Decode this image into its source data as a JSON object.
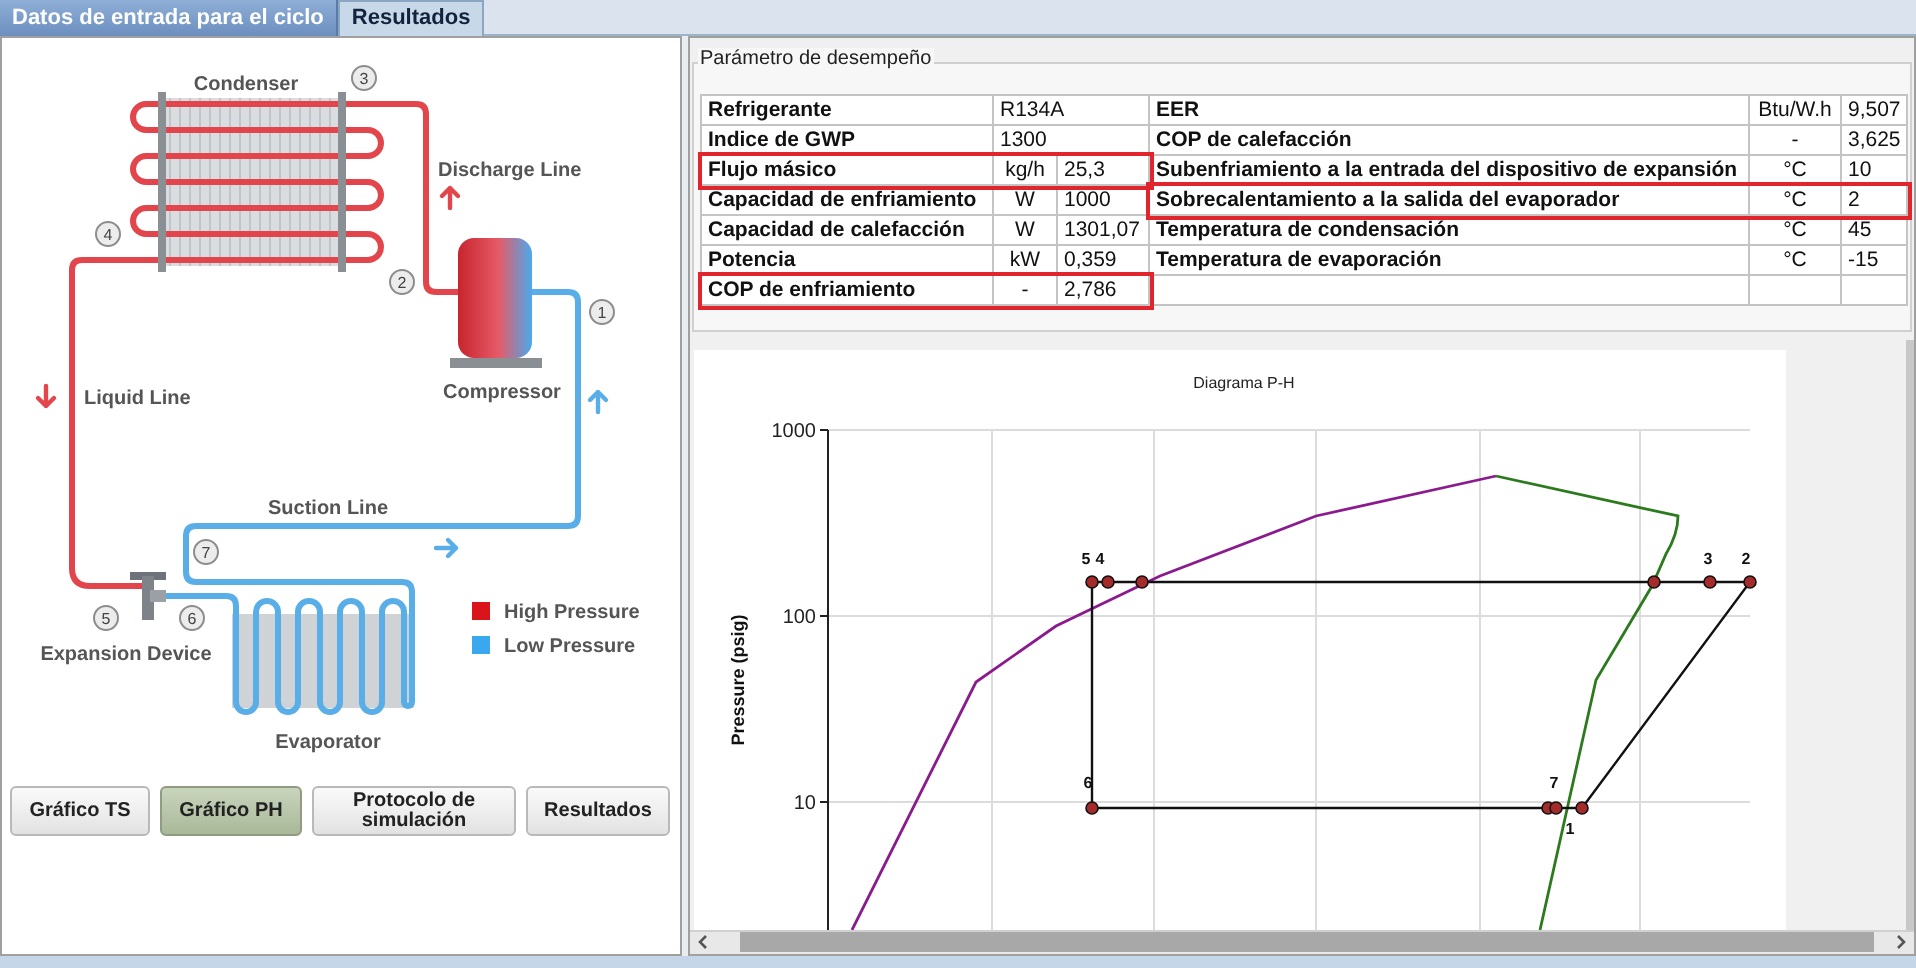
{
  "tabs": [
    {
      "label": "Datos de entrada para el ciclo",
      "selected": false
    },
    {
      "label": "Resultados",
      "selected": true
    }
  ],
  "diagram": {
    "component_labels": [
      "Condenser",
      "Discharge Line",
      "Liquid Line",
      "Compressor",
      "Suction Line",
      "Expansion Device",
      "Evaporator"
    ],
    "point_numbers": [
      "1",
      "2",
      "3",
      "4",
      "5",
      "6",
      "7"
    ],
    "legend": [
      {
        "label": "High Pressure",
        "color": "#d9141b"
      },
      {
        "label": "Low Pressure",
        "color": "#3aa8ee"
      }
    ]
  },
  "buttons": [
    {
      "label": "Gráfico TS",
      "selected": false
    },
    {
      "label": "Gráfico PH",
      "selected": true
    },
    {
      "label": "Protocolo de simulación",
      "selected": false
    },
    {
      "label": "Resultados",
      "selected": false
    }
  ],
  "performance": {
    "title": "Parámetro de desempeño",
    "rows": [
      {
        "left": {
          "label": "Refrigerante",
          "value": "R134A",
          "highlighted": false
        },
        "right": {
          "label": "EER",
          "unit": "Btu/W.h",
          "value": "9,507",
          "highlighted": false
        }
      },
      {
        "left": {
          "label": "Indice de GWP",
          "value": "1300",
          "highlighted": false
        },
        "right": {
          "label": "COP de calefacción",
          "unit": "-",
          "value": "3,625",
          "highlighted": false
        }
      },
      {
        "left": {
          "label": "Flujo másico",
          "unit": "kg/h",
          "value": "25,3",
          "highlighted": true
        },
        "right": {
          "label": "Subenfriamiento a la entrada del dispositivo de expansión",
          "unit": "°C",
          "value": "10",
          "highlighted": false
        }
      },
      {
        "left": {
          "label": "Capacidad de enfriamiento",
          "unit": "W",
          "value": "1000",
          "highlighted": false
        },
        "right": {
          "label": "Sobrecalentamiento a la salida del evaporador",
          "unit": "°C",
          "value": "2",
          "highlighted": true
        }
      },
      {
        "left": {
          "label": "Capacidad de calefacción",
          "unit": "W",
          "value": "1301,07",
          "highlighted": false
        },
        "right": {
          "label": "Temperatura de condensación",
          "unit": "°C",
          "value": "45",
          "highlighted": false
        }
      },
      {
        "left": {
          "label": "Potencia",
          "unit": "kW",
          "value": "0,359",
          "highlighted": false
        },
        "right": {
          "label": "Temperatura de evaporación",
          "unit": "°C",
          "value": "-15",
          "highlighted": false
        }
      },
      {
        "left": {
          "label": "COP de enfriamiento",
          "unit": "-",
          "value": "2,786",
          "highlighted": true
        }
      }
    ]
  },
  "ph_diagram": {
    "title": "Diagrama P-H",
    "ylabel": "Pressure (psig)",
    "ytick_labels": [
      "1000",
      "100",
      "10"
    ],
    "point_labels": [
      "5",
      "4",
      "3",
      "2",
      "6",
      "7",
      "1"
    ]
  }
}
